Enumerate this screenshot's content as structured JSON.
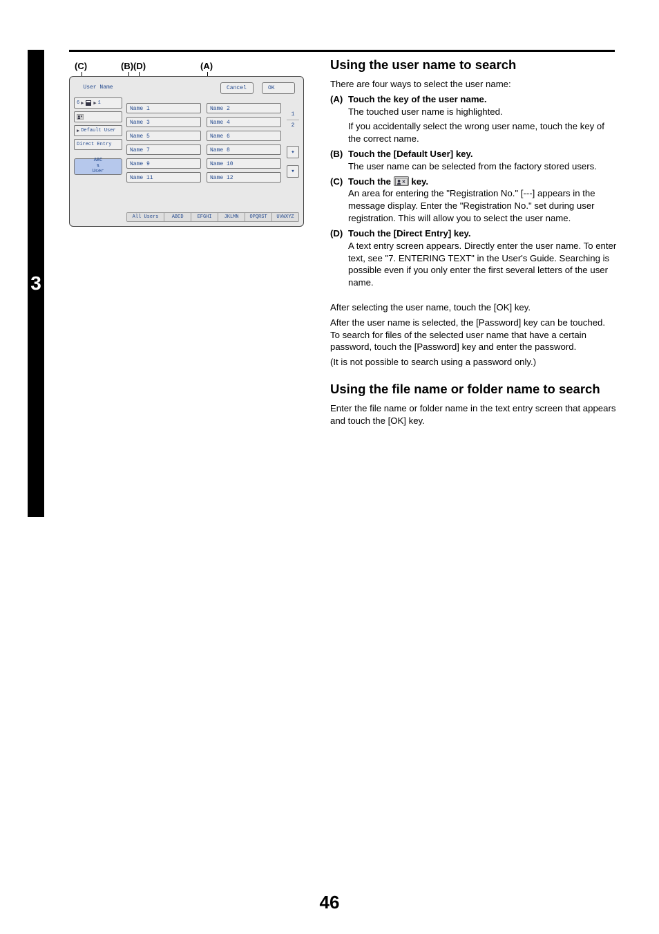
{
  "sideTab": "3",
  "pageNumber": "46",
  "callouts": {
    "c": "(C)",
    "b": "(B)",
    "d": "(D)",
    "a": "(A)"
  },
  "panel": {
    "title": "User Name",
    "cancel": "Cancel",
    "ok": "OK",
    "leftKeys": {
      "crumb_6": "6",
      "crumb_1": "1",
      "person": "person-icon",
      "defaultUser": "Default User",
      "directEntry": "Direct Entry",
      "abc_top": "ABC",
      "abc_bottom": "User"
    },
    "names": [
      "Name 1",
      "Name 2",
      "Name 3",
      "Name 4",
      "Name 5",
      "Name 6",
      "Name 7",
      "Name 8",
      "Name 9",
      "Name 10",
      "Name 11",
      "Name 12"
    ],
    "page": {
      "current": "1",
      "total": "2"
    },
    "tabs": [
      "All Users",
      "ABCD",
      "EFGHI",
      "JKLMN",
      "OPQRST",
      "UVWXYZ"
    ]
  },
  "right": {
    "h1": "Using the user name to search",
    "intro": "There are four ways to select the user name:",
    "a_hd_lab": "(A)",
    "a_hd_txt": "Touch the key of the user name.",
    "a_p1": "The touched user name is highlighted.",
    "a_p2": "If you accidentally select the wrong user name, touch the key of the correct name.",
    "b_hd_lab": "(B)",
    "b_hd_txt": "Touch the [Default User] key.",
    "b_p1": "The user name can be selected from the factory stored users.",
    "c_hd_lab": "(C)",
    "c_hd_pre": "Touch the ",
    "c_hd_post": " key.",
    "c_p1": "An area for entering the \"Registration No.\" [---] appears in the message display. Enter the \"Registration No.\" set during user registration. This will allow you to select the user name.",
    "d_hd_lab": "(D)",
    "d_hd_txt": "Touch the [Direct Entry] key.",
    "d_p1": "A text entry screen appears. Directly enter the user name. To enter text, see \"7. ENTERING TEXT\" in the User's Guide. Searching is possible even if you only enter the first several letters of the user name.",
    "after1": "After selecting the user name, touch the [OK] key.",
    "after2": "After the user name is selected, the [Password] key can be touched. To search for files of the selected user name that have a certain password, touch the [Password] key and enter the password.",
    "after3": "(It is not possible to search using a password only.)",
    "h2": "Using the file name or folder name to search",
    "h2_p1": "Enter the file name or folder name in the text entry screen that appears and touch the [OK] key."
  }
}
